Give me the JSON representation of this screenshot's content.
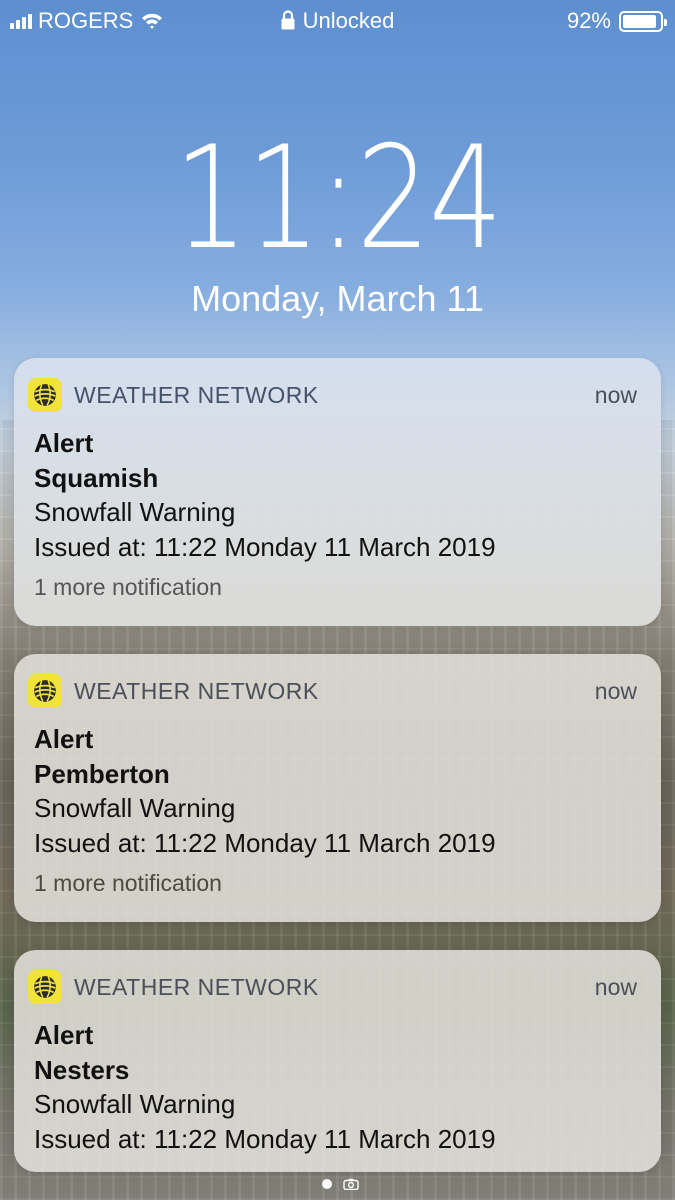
{
  "status_bar": {
    "carrier": "ROGERS",
    "center": "Unlocked",
    "battery_percent": "92%",
    "battery_level": 0.92,
    "signal_bars": 4
  },
  "lock_screen": {
    "time": "11:24",
    "date": "Monday, March 11"
  },
  "notifications": [
    {
      "app": "WEATHER NETWORK",
      "time": "now",
      "title": "Alert",
      "location": "Squamish",
      "message": "Snowfall Warning",
      "issued": "Issued at: 11:22 Monday 11 March 2019",
      "more": "1 more notification"
    },
    {
      "app": "WEATHER NETWORK",
      "time": "now",
      "title": "Alert",
      "location": "Pemberton",
      "message": "Snowfall Warning",
      "issued": "Issued at: 11:22 Monday 11 March 2019",
      "more": "1 more notification"
    },
    {
      "app": "WEATHER NETWORK",
      "time": "now",
      "title": "Alert",
      "location": "Nesters",
      "message": "Snowfall Warning",
      "issued": "Issued at: 11:22 Monday 11 March 2019"
    }
  ],
  "icons": {
    "app_icon": "weather-network-globe-icon",
    "lock": "lock-icon",
    "wifi": "wifi-icon",
    "battery": "battery-icon",
    "camera": "camera-icon"
  },
  "colors": {
    "app_icon_bg": "#f2e33a",
    "text_white": "#ffffff"
  }
}
